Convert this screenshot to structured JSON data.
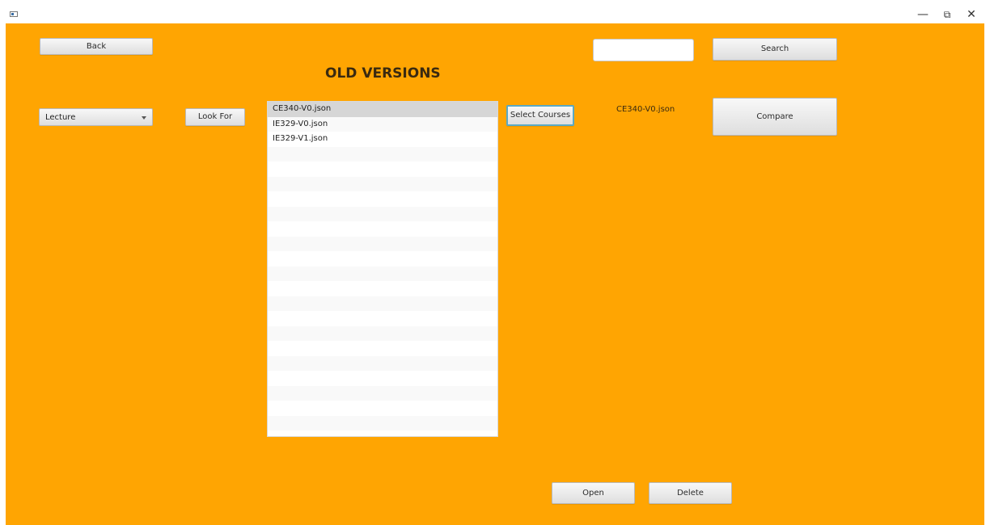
{
  "window": {
    "minimize": "—",
    "restore": "⧉",
    "close": "✕"
  },
  "header": {
    "title": "OLD VERSIONS",
    "back_label": "Back",
    "search_label": "Search",
    "search_value": ""
  },
  "filters": {
    "type_selected": "Lecture",
    "look_for_label": "Look For"
  },
  "files": {
    "items": [
      "CE340-V0.json",
      "IE329-V0.json",
      "IE329-V1.json"
    ],
    "selected_index": 0
  },
  "actions": {
    "select_courses_label": "Select Courses",
    "selected_file": "CE340-V0.json",
    "compare_label": "Compare",
    "open_label": "Open",
    "delete_label": "Delete"
  },
  "colors": {
    "background": "#ffa502"
  }
}
